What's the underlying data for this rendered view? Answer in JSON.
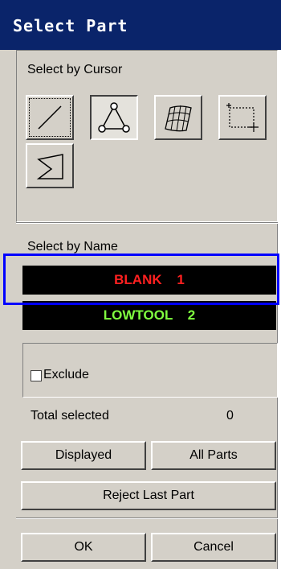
{
  "window": {
    "title": "Select Part"
  },
  "cursor_section": {
    "label": "Select by Cursor",
    "tools": [
      {
        "icon": "line-icon"
      },
      {
        "icon": "triangle-nodes-icon"
      },
      {
        "icon": "surface-mesh-icon"
      },
      {
        "icon": "box-select-icon"
      },
      {
        "icon": "polygon-select-icon"
      }
    ]
  },
  "name_section": {
    "label": "Select by Name",
    "parts": [
      {
        "name": "BLANK",
        "id": "1",
        "color": "#ff2020"
      },
      {
        "name": "LOWTOOL",
        "id": "2",
        "color": "#80ff40"
      }
    ]
  },
  "exclude": {
    "label": "Exclude",
    "checked": false
  },
  "total": {
    "label": "Total selected",
    "value": "0"
  },
  "buttons": {
    "displayed": "Displayed",
    "all_parts": "All Parts",
    "reject_last": "Reject Last Part",
    "ok": "OK",
    "cancel": "Cancel"
  },
  "colors": {
    "titlebar": "#0a246a",
    "face": "#d4d0c8",
    "highlight": "#0000ff"
  }
}
